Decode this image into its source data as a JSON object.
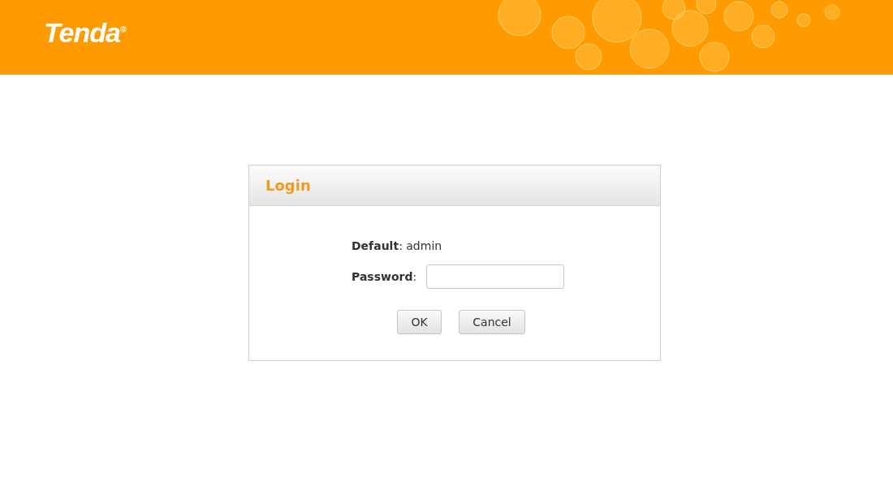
{
  "header": {
    "logo": "Tenda$^{®}$"
  },
  "login": {
    "title": "Login",
    "default_text": "**Default**: admin",
    "password_label": "**Password**:",
    "buttons": [
      {
        "label": "OK",
        "kind": "ok"
      },
      {
        "label": "Cancel",
        "kind": "cancel"
      }
    ]
  }
}
